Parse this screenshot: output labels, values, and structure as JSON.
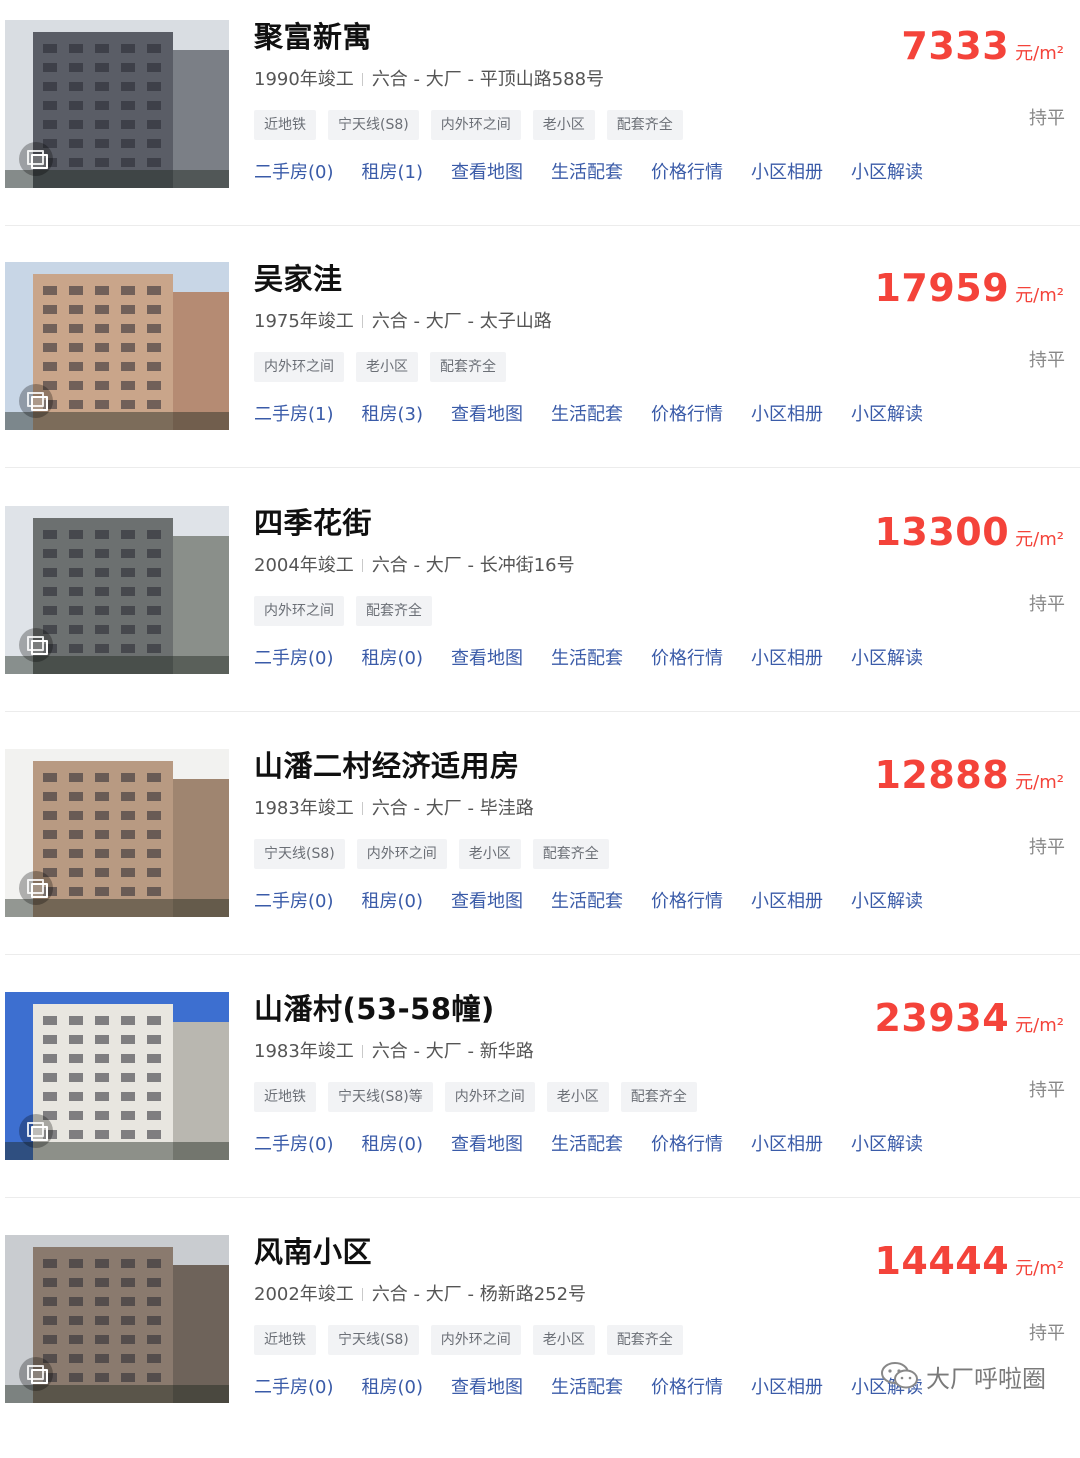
{
  "listings": [
    {
      "name": "聚富新寓",
      "year": "1990年竣工",
      "location": "六合 - 大厂 - 平顶山路588号",
      "tags": [
        "近地铁",
        "宁天线(S8)",
        "内外环之间",
        "老小区",
        "配套齐全"
      ],
      "links": [
        "二手房(0)",
        "租房(1)",
        "查看地图",
        "生活配套",
        "价格行情",
        "小区相册",
        "小区解读"
      ],
      "price": "7333",
      "price_unit": "元/m²",
      "trend": "持平",
      "photo_icon": "album-icon"
    },
    {
      "name": "吴家洼",
      "year": "1975年竣工",
      "location": "六合 - 大厂 - 太子山路",
      "tags": [
        "内外环之间",
        "老小区",
        "配套齐全"
      ],
      "links": [
        "二手房(1)",
        "租房(3)",
        "查看地图",
        "生活配套",
        "价格行情",
        "小区相册",
        "小区解读"
      ],
      "price": "17959",
      "price_unit": "元/m²",
      "trend": "持平",
      "photo_icon": "album-icon"
    },
    {
      "name": "四季花街",
      "year": "2004年竣工",
      "location": "六合 - 大厂 - 长冲街16号",
      "tags": [
        "内外环之间",
        "配套齐全"
      ],
      "links": [
        "二手房(0)",
        "租房(0)",
        "查看地图",
        "生活配套",
        "价格行情",
        "小区相册",
        "小区解读"
      ],
      "price": "13300",
      "price_unit": "元/m²",
      "trend": "持平",
      "photo_icon": "album-icon"
    },
    {
      "name": "山潘二村经济适用房",
      "year": "1983年竣工",
      "location": "六合 - 大厂 - 毕洼路",
      "tags": [
        "宁天线(S8)",
        "内外环之间",
        "老小区",
        "配套齐全"
      ],
      "links": [
        "二手房(0)",
        "租房(0)",
        "查看地图",
        "生活配套",
        "价格行情",
        "小区相册",
        "小区解读"
      ],
      "price": "12888",
      "price_unit": "元/m²",
      "trend": "持平",
      "photo_icon": "album-icon"
    },
    {
      "name": "山潘村(53-58幢)",
      "year": "1983年竣工",
      "location": "六合 - 大厂 - 新华路",
      "tags": [
        "近地铁",
        "宁天线(S8)等",
        "内外环之间",
        "老小区",
        "配套齐全"
      ],
      "links": [
        "二手房(0)",
        "租房(0)",
        "查看地图",
        "生活配套",
        "价格行情",
        "小区相册",
        "小区解读"
      ],
      "price": "23934",
      "price_unit": "元/m²",
      "trend": "持平",
      "photo_icon": "album-icon"
    },
    {
      "name": "风南小区",
      "year": "2002年竣工",
      "location": "六合 - 大厂 - 杨新路252号",
      "tags": [
        "近地铁",
        "宁天线(S8)",
        "内外环之间",
        "老小区",
        "配套齐全"
      ],
      "links": [
        "二手房(0)",
        "租房(0)",
        "查看地图",
        "生活配套",
        "价格行情",
        "小区相册",
        "小区解读"
      ],
      "price": "14444",
      "price_unit": "元/m²",
      "trend": "持平",
      "photo_icon": "album-icon"
    }
  ],
  "watermark": {
    "text": "大厂呼啦圈",
    "icon": "wechat-icon"
  }
}
